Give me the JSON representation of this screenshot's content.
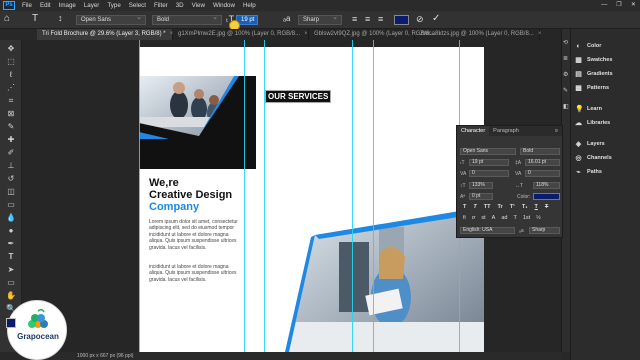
{
  "menubar": {
    "logo": "Ps",
    "items": [
      "File",
      "Edit",
      "Image",
      "Layer",
      "Type",
      "Select",
      "Filter",
      "3D",
      "View",
      "Window",
      "Help"
    ],
    "window_controls": [
      "—",
      "❐",
      "✕"
    ]
  },
  "options": {
    "font_family": "Open Sans",
    "font_style": "Bold",
    "font_size": "19 pt",
    "antialias": "Sharp",
    "color": "#0a1c6e"
  },
  "tabs": [
    {
      "label": "Tri Fold Brochure @ 29.6% (Layer 3, RGB/8) *"
    },
    {
      "label": "g1XmPlmw2E.jpg @ 100% (Layer 0, RGB/8..."
    },
    {
      "label": "Gblsw2vl9QZ.jpg @ 100% (Layer 0, RGB/8..."
    },
    {
      "label": "Zmca8Ltzs.jpg @ 100% (Layer 0, RGB/8..."
    }
  ],
  "document": {
    "heading1": "We,re",
    "heading2": "Creative Design",
    "heading3": "Company",
    "para1": "Lorem ipsum dolor sit amet, consectetur adipiscing elit, sed do eiusmod tempor incididunt ut labore et dolore magna aliqua. Quis ipsum suspendisse ultrices gravida. lacus vel facilisis.",
    "para2": "incididunt ut labore et dolore magna aliqua. Quis ipsum suspendisse ultrices gravida. lacus vel facilisis.",
    "services": "OUR SERVICES"
  },
  "status": {
    "text": "1000 px x 667 px (96 ppi)"
  },
  "right_panel": [
    "Color",
    "Swatches",
    "Gradients",
    "Patterns",
    "Learn",
    "Libraries",
    "Layers",
    "Channels",
    "Paths"
  ],
  "character": {
    "tabs": [
      "Character",
      "Paragraph"
    ],
    "font": "Open Sans",
    "style": "Bold",
    "size": "19 pt",
    "leading": "16.01 pt",
    "kerning": "0",
    "tracking": "0",
    "vscale": "133%",
    "hscale": "118%",
    "baseline": "0 pt",
    "color_label": "Color:",
    "language": "English: USA",
    "aa": "Sharp",
    "style_glyphs": [
      "T",
      "T",
      "TT",
      "Tr",
      "T¹",
      "T₁",
      "T",
      "T"
    ],
    "ot_glyphs": [
      "fi",
      "ơ",
      "st",
      "A",
      "ad",
      "T",
      "1st",
      "½"
    ]
  },
  "logo_text": "Grapocean",
  "colors": {
    "accent": "#1e88e5",
    "navy": "#0a1c6e",
    "guide": "#22d6f2"
  }
}
